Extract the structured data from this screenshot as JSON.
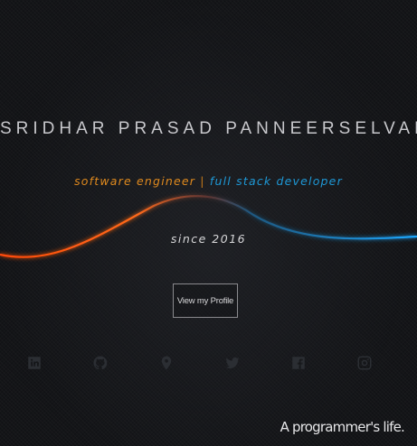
{
  "hero": {
    "name": "SRIDHAR PRASAD PANNEERSELVAM",
    "role_primary": "software engineer",
    "separator": "|",
    "role_secondary": "full stack developer",
    "since": "since 2016",
    "profile_button": "View my Profile"
  },
  "social": [
    {
      "icon": "linkedin-icon"
    },
    {
      "icon": "github-icon"
    },
    {
      "icon": "location-pin-icon"
    },
    {
      "icon": "twitter-icon"
    },
    {
      "icon": "facebook-icon"
    },
    {
      "icon": "instagram-icon"
    }
  ],
  "footer": {
    "tagline": "A programmer's life."
  },
  "colors": {
    "accent_orange": "#e08a1e",
    "accent_blue": "#1e98d6",
    "background": "#141518"
  }
}
